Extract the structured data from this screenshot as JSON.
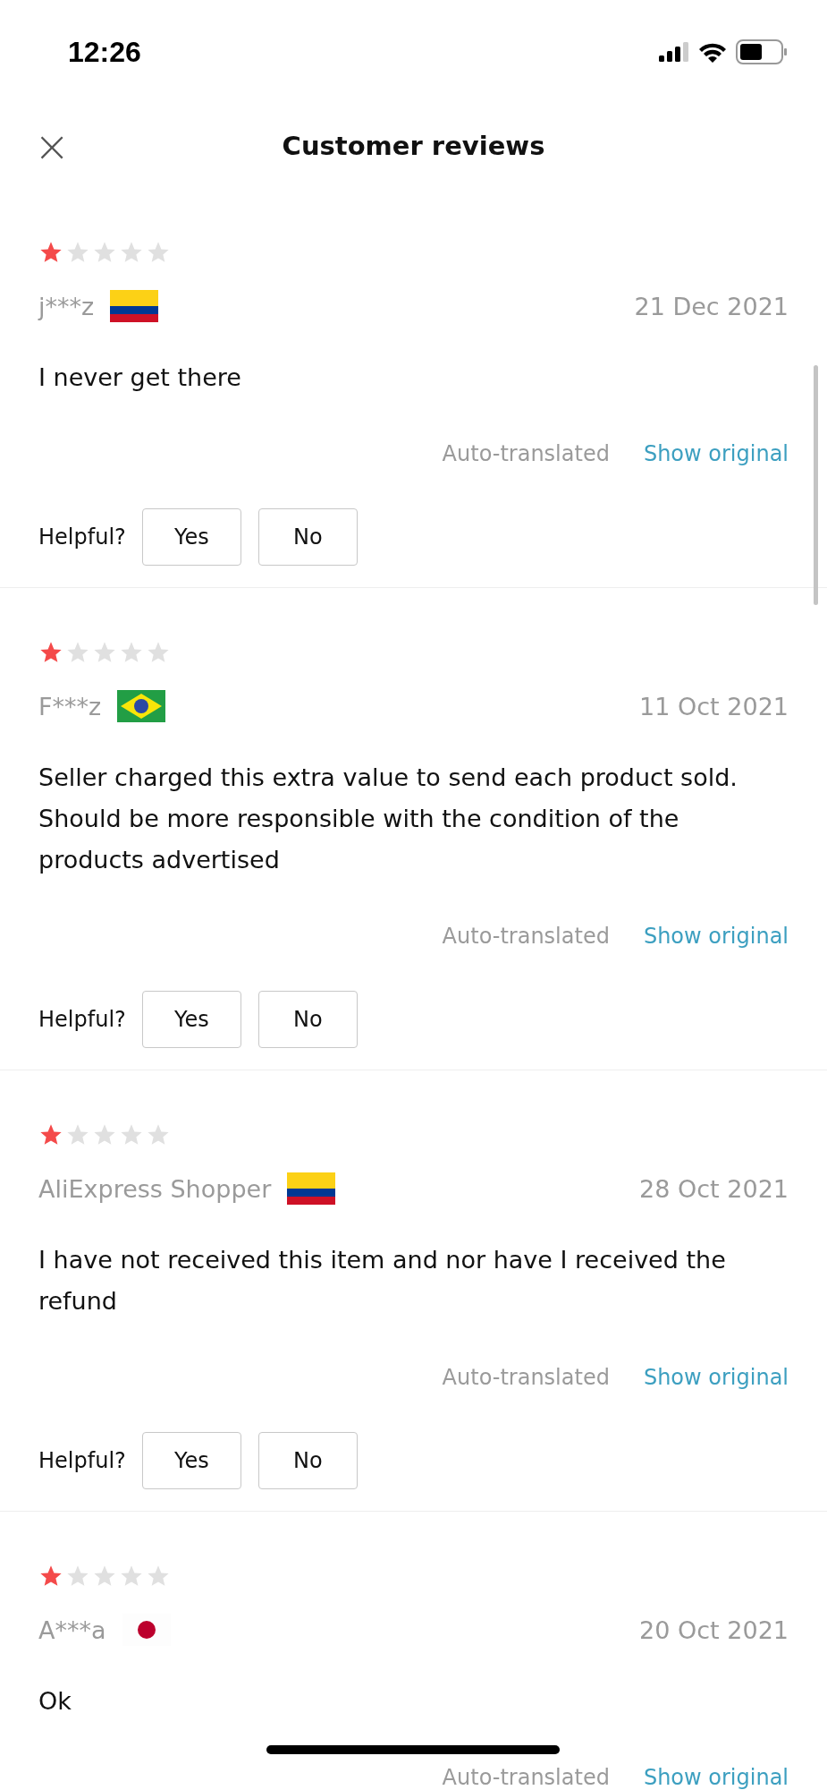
{
  "status_bar": {
    "time": "12:26"
  },
  "header": {
    "close": "×",
    "title": "Customer reviews"
  },
  "reviews": [
    {
      "stars": 1,
      "name": "j***z",
      "flag": {
        "kind": "tricolor"
      },
      "date": "21 Dec 2021",
      "text": "I never get there",
      "translated_note": "Auto-translated",
      "show_original": "Show original",
      "helpful": {
        "label": "Helpful?",
        "yes": "Yes",
        "no": "No"
      }
    },
    {
      "stars": 1,
      "name": "F***z",
      "flag": {
        "kind": "diamond"
      },
      "date": "11 Oct 2021",
      "text": "Seller charged this extra value to send each product sold. Should be more responsible with the condition of the products advertised",
      "translated_note": "Auto-translated",
      "show_original": "Show original",
      "helpful": {
        "label": "Helpful?",
        "yes": "Yes",
        "no": "No"
      }
    },
    {
      "stars": 1,
      "name": "AliExpress Shopper",
      "flag": {
        "kind": "tricolor"
      },
      "date": "28 Oct 2021",
      "text": "I have not received this item and nor have I received the refund",
      "translated_note": "Auto-translated",
      "show_original": "Show original",
      "helpful": {
        "label": "Helpful?",
        "yes": "Yes",
        "no": "No"
      }
    },
    {
      "stars": 1,
      "name": "A***a",
      "flag": {
        "kind": "disc"
      },
      "date": "20 Oct 2021",
      "text": "Ok",
      "translated_note": "Auto-translated",
      "show_original": "Show original"
    }
  ]
}
